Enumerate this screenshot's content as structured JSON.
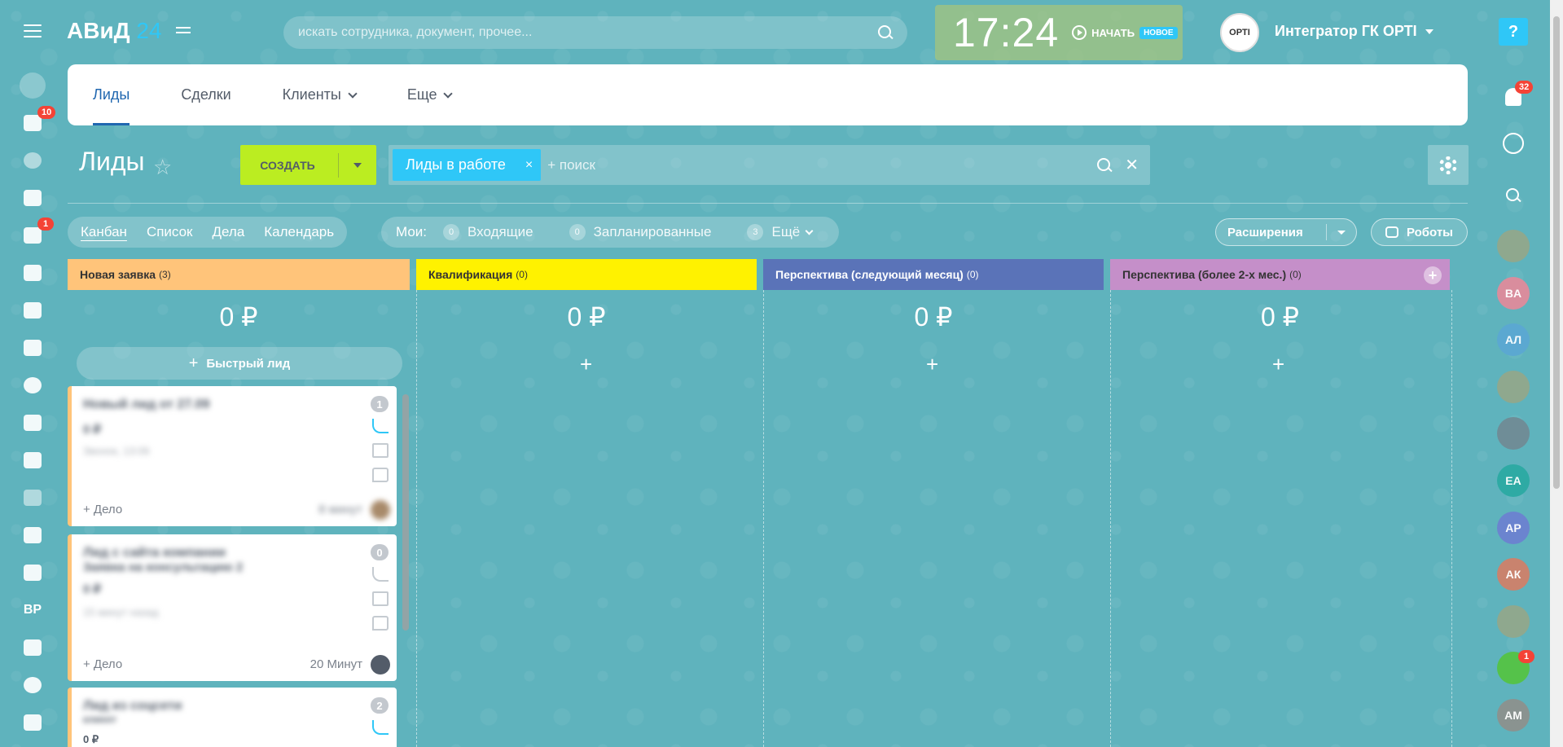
{
  "header": {
    "logo": "АВиД",
    "logo_num": "24",
    "search_placeholder": "искать сотрудника, документ, прочее...",
    "clock": "17:24",
    "start_label": "НАЧАТЬ",
    "new_badge": "НОВОЕ",
    "company_avatar": "OPTI",
    "company_name": "Интегратор ГК ОРТІ",
    "help": "?"
  },
  "left_sidebar": {
    "badges": {
      "tasks": "10",
      "chat": "1"
    },
    "bp_label": "BP"
  },
  "right_bar": {
    "notifications_count": "32",
    "group_badge": "1",
    "avatars": [
      {
        "kind": "photo",
        "color": "#8fa88e"
      },
      {
        "kind": "initials",
        "text": "BA",
        "color": "#d98d9d"
      },
      {
        "kind": "initials",
        "text": "АЛ",
        "color": "#5ba8d1"
      },
      {
        "kind": "photo",
        "color": "#8fa88e"
      },
      {
        "kind": "photo",
        "color": "#6f8d97"
      },
      {
        "kind": "initials",
        "text": "ЕА",
        "color": "#2eaaa4"
      },
      {
        "kind": "initials",
        "text": "АР",
        "color": "#6b84cf"
      },
      {
        "kind": "initials",
        "text": "АК",
        "color": "#c9836e"
      },
      {
        "kind": "photo",
        "color": "#8fa88e"
      },
      {
        "kind": "group",
        "color": "#55c24a"
      },
      {
        "kind": "initials",
        "text": "АМ",
        "color": "#8a9390"
      }
    ]
  },
  "tabs": [
    {
      "label": "Лиды",
      "active": true,
      "dropdown": false
    },
    {
      "label": "Сделки",
      "active": false,
      "dropdown": false
    },
    {
      "label": "Клиенты",
      "active": false,
      "dropdown": true
    },
    {
      "label": "Еще",
      "active": false,
      "dropdown": true
    }
  ],
  "toolbar": {
    "title": "Лиды",
    "star": "☆",
    "create_label": "СОЗДАТЬ",
    "filter_tag": "Лиды в работе",
    "filter_tag_close": "×",
    "filter_search": "+ поиск",
    "filter_clear": "✕"
  },
  "view_switch": [
    "Канбан",
    "Список",
    "Дела",
    "Календарь"
  ],
  "counters": {
    "mine": "Мои:",
    "items": [
      {
        "num": "0",
        "label": "Входящие"
      },
      {
        "num": "0",
        "label": "Запланированные"
      },
      {
        "num": "3",
        "label": "Ещё"
      }
    ]
  },
  "extensions_label": "Расширения",
  "robots_label": "Роботы",
  "stages": [
    {
      "name": "Новая заявка",
      "count": "(3)",
      "color": "#ffc47a",
      "sum": "0 ₽"
    },
    {
      "name": "Квалификация",
      "count": "(0)",
      "color": "#fff200",
      "sum": "0 ₽"
    },
    {
      "name": "Перспектива (следующий месяц)",
      "count": "(0)",
      "color": "#5a73b8",
      "sum": "0 ₽"
    },
    {
      "name": "Перспектива (более 2-х мес.)",
      "count": "(0)",
      "color": "#c58fc9",
      "sum": "0 ₽"
    }
  ],
  "quick_lead": "Быстрый лид",
  "col_plus": "+",
  "cards": [
    {
      "badge": "1",
      "title": "Новый лид от 27.09",
      "line2": "0 ₽",
      "line3": "Звонок, 13:06",
      "deal": "+ Дело",
      "time": "8 минут",
      "owner": "photo"
    },
    {
      "badge": "0",
      "title": "Лид с сайта компании",
      "line2b": "Заявка на консультацию 2",
      "line2": "0 ₽",
      "line3": "15 минут назад",
      "deal": "+ Дело",
      "time": "20 Минут",
      "owner": "default"
    },
    {
      "badge": "2",
      "title": "Лид из соцсети",
      "line2b": "клиент",
      "line2": "0 ₽",
      "line3": ""
    }
  ]
}
